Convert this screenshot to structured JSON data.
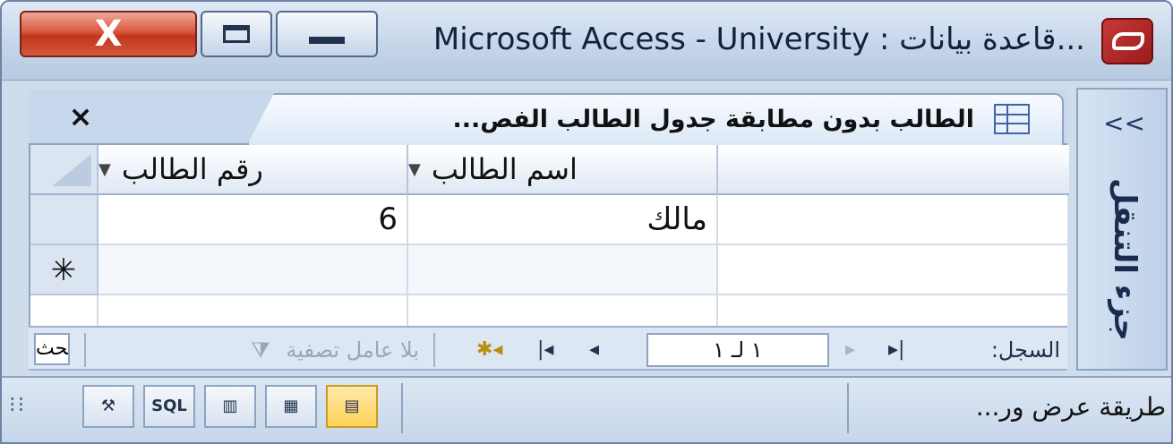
{
  "window": {
    "title": "Microsoft Access - University : قاعدة بيانات...",
    "close_glyph": "X"
  },
  "tab": {
    "label": "الطالب بدون مطابقة جدول الطالب الفص...",
    "close_glyph": "×"
  },
  "nav_pane": {
    "chevron": "<<",
    "label": "جزء التنقل"
  },
  "datasheet": {
    "columns": [
      {
        "label": "اسم الطالب"
      },
      {
        "label": "رقم الطالب"
      }
    ],
    "rows": [
      {
        "name": "مالك",
        "id": "6"
      }
    ],
    "new_row_marker": "✳"
  },
  "record_nav": {
    "record_label": "السجل:",
    "position": "١ لـ ١",
    "filter_label": "بلا عامل تصفية",
    "search_text": "بحث"
  },
  "status_bar": {
    "text": "طريقة عرض ور...",
    "view_buttons": [
      "datasheet-view",
      "pivottable-view",
      "pivotchart-view",
      "SQL",
      "design-view"
    ],
    "sql_label": "SQL"
  },
  "colors": {
    "close_button": "#c0351d",
    "frame": "#cfdcec",
    "active_view": "#ffd35a"
  }
}
